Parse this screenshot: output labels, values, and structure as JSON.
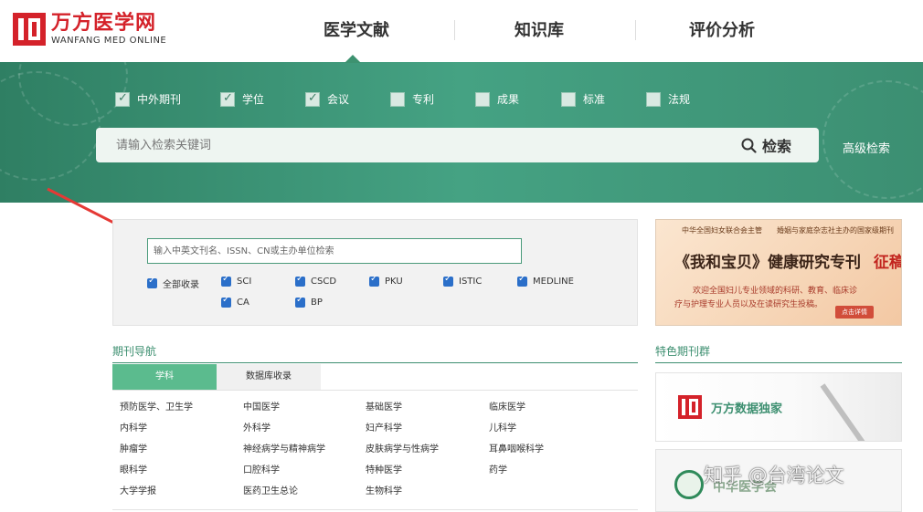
{
  "logo": {
    "cn": "万方医学网",
    "en": "WANFANG MED ONLINE"
  },
  "nav": [
    {
      "label": "医学文献",
      "active": true
    },
    {
      "label": "知识库",
      "active": false
    },
    {
      "label": "评价分析",
      "active": false
    }
  ],
  "filters": [
    {
      "label": "中外期刊",
      "checked": true
    },
    {
      "label": "学位",
      "checked": true
    },
    {
      "label": "会议",
      "checked": true
    },
    {
      "label": "专利",
      "checked": false
    },
    {
      "label": "成果",
      "checked": false
    },
    {
      "label": "标准",
      "checked": false
    },
    {
      "label": "法规",
      "checked": false
    }
  ],
  "search": {
    "placeholder": "请输入检索关键词",
    "button_label": "检索",
    "advanced_label": "高级检索"
  },
  "journal_search": {
    "placeholder": "输入中英文刊名、ISSN、CN或主办单位检索",
    "options": [
      {
        "label": "全部收录",
        "checked": true
      },
      {
        "label": "SCI",
        "checked": true
      },
      {
        "label": "CSCD",
        "checked": true
      },
      {
        "label": "PKU",
        "checked": true
      },
      {
        "label": "ISTIC",
        "checked": true
      },
      {
        "label": "MEDLINE",
        "checked": true
      },
      {
        "label": "CA",
        "checked": true
      },
      {
        "label": "BP",
        "checked": true
      }
    ]
  },
  "journal_nav": {
    "title": "期刊导航",
    "tabs": [
      {
        "label": "学科",
        "active": true
      },
      {
        "label": "数据库收录",
        "active": false
      }
    ],
    "subjects": [
      "预防医学、卫生学",
      "中国医学",
      "基础医学",
      "临床医学",
      "内科学",
      "外科学",
      "妇产科学",
      "儿科学",
      "肿瘤学",
      "神经病学与精神病学",
      "皮肤病学与性病学",
      "耳鼻咽喉科学",
      "眼科学",
      "口腔科学",
      "特种医学",
      "药学",
      "大学学报",
      "医药卫生总论",
      "生物科学"
    ]
  },
  "ad": {
    "top": "中华全国妇女联合会主管　　婚姻与家庭杂志社主办的国家级期刊",
    "title_left": "《我和宝贝》健康研究专刊",
    "title_right": "征稿启事",
    "line1": "欢迎全国妇儿专业领域的科研、教育、临床诊",
    "line2": "疗与护理专业人员以及在读研究生投稿。",
    "button": "点击详情"
  },
  "featured": {
    "title": "特色期刊群",
    "item1": "万方数据独家",
    "item2": "中华医学会"
  },
  "watermark": "知乎 @台湾论文",
  "colors": {
    "brand_red": "#d4222a",
    "brand_green": "#3d8f70",
    "tab_green": "#5bbb8e",
    "checkbox_blue": "#2b6fc9"
  }
}
